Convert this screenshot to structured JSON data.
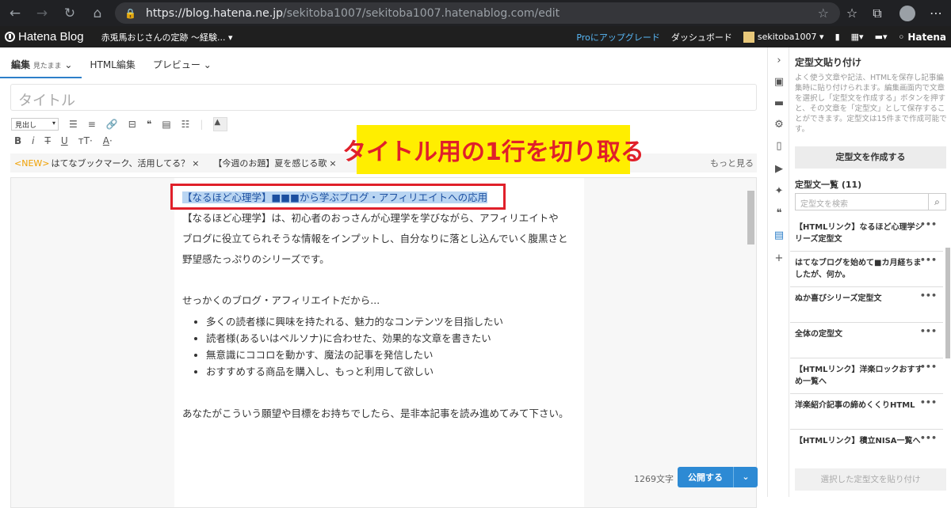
{
  "browser": {
    "url_host": "https://blog.hatena.ne.jp",
    "url_path": "/sekitoba1007/sekitoba1007.hatenablog.com/edit"
  },
  "topbar": {
    "logo": "Hatena Blog",
    "blog_name": "赤兎馬おじさんの定跡 ～経験...",
    "pro_upgrade": "Proにアップグレード",
    "dashboard": "ダッシュボード",
    "user": "sekitoba1007",
    "hatena": "Hatena"
  },
  "editor": {
    "tabs": [
      {
        "label": "編集",
        "sub": "見たまま"
      },
      {
        "label": "HTML編集"
      },
      {
        "label": "プレビュー"
      }
    ],
    "title_placeholder": "タイトル",
    "format_select": "見出し",
    "news": {
      "new_tag": "<NEW>",
      "item1": "はてなブックマーク、活用してる？",
      "item2": "【今週のお題】夏を感じる歌",
      "more": "もっと見る"
    },
    "body": {
      "highlight_line": "【なるほど心理学】■■■から学ぶブログ・アフィリエイトへの応用",
      "para1_l1": "【なるほど心理学】は、初心者のおっさんが心理学を学びながら、アフィリエイトや",
      "para1_l2": "ブログに役立てられそうな情報をインプットし、自分なりに落とし込んでいく腹黒さと",
      "para1_l3": "野望感たっぷりのシリーズです。",
      "para2": "せっかくのブログ・アフィリエイトだから...",
      "bullets": [
        "多くの読者様に興味を持たれる、魅力的なコンテンツを目指したい",
        "読者様(あるいはペルソナ)に合わせた、効果的な文章を書きたい",
        "無意識にココロを動かす、魔法の記事を発信したい",
        "おすすめする商品を購入し、もっと利用して欲しい"
      ],
      "para3": "あなたがこういう願望や目標をお持ちでしたら、是非本記事を読み進めてみて下さい。"
    },
    "annotation": "タイトル用の1行を切り取る",
    "char_count": "1269文字",
    "publish": "公開する"
  },
  "sidebar": {
    "title": "定型文貼り付け",
    "description": "よく使う文章や記法、HTMLを保存し記事編集時に貼り付けられます。編集画面内で文章を選択し「定型文を作成する」ボタンを押すと、その文章を「定型文」として保存することができます。定型文は15件まで作成可能です。",
    "create_button": "定型文を作成する",
    "list_header": "定型文一覧 (11)",
    "search_placeholder": "定型文を検索",
    "items": [
      "【HTMLリンク】なるほど心理学シリーズ定型文",
      "はてなブログを始めて■カ月経ちましたが、何か。",
      "ぬか喜びシリーズ定型文",
      "全体の定型文",
      "【HTMLリンク】洋楽ロックおすすめ一覧へ",
      "洋楽紹介記事の締めくくりHTML",
      "【HTMLリンク】積立NISA一覧へ"
    ],
    "paste_button": "選択した定型文を貼り付け"
  }
}
